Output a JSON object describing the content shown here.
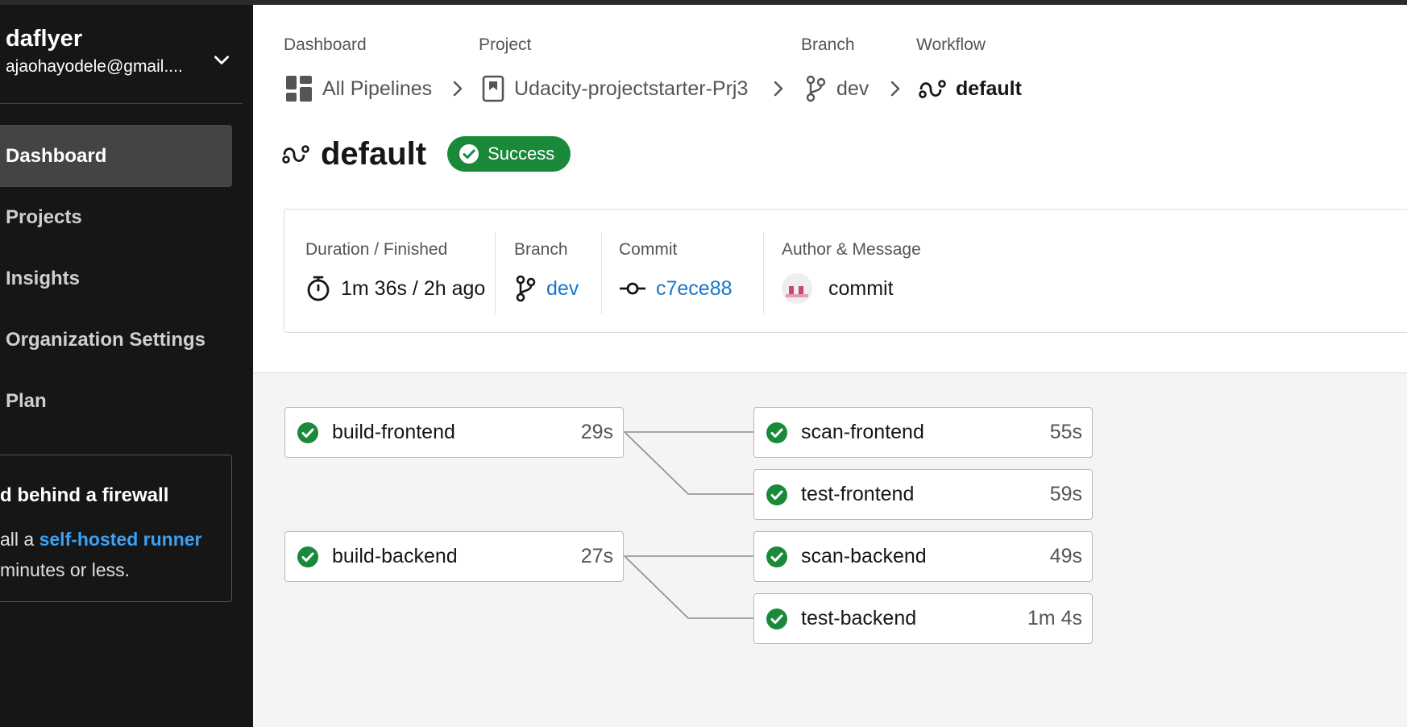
{
  "sidebar": {
    "user": {
      "name": "daflyer",
      "email": "ajaohayodele@gmail...."
    },
    "nav": [
      {
        "label": "Dashboard",
        "active": true
      },
      {
        "label": "Projects"
      },
      {
        "label": "Insights"
      },
      {
        "label": "Organization Settings"
      },
      {
        "label": "Plan"
      }
    ],
    "firewall": {
      "title": "d behind a firewall",
      "text_before": "all a ",
      "link": "self-hosted runner",
      "text_after": "minutes or less."
    }
  },
  "breadcrumb": {
    "dashboard": {
      "label": "Dashboard",
      "value": "All Pipelines"
    },
    "project": {
      "label": "Project",
      "value": "Udacity-projectstarter-Prj3"
    },
    "branch": {
      "label": "Branch",
      "value": "dev"
    },
    "workflow": {
      "label": "Workflow",
      "value": "default"
    }
  },
  "workflow": {
    "title": "default",
    "status": "Success"
  },
  "info": {
    "duration": {
      "label": "Duration / Finished",
      "value": "1m 36s / 2h ago"
    },
    "branch": {
      "label": "Branch",
      "value": "dev"
    },
    "commit": {
      "label": "Commit",
      "value": "c7ece88"
    },
    "author": {
      "label": "Author & Message",
      "value": "commit"
    }
  },
  "jobs": [
    {
      "name": "build-frontend",
      "duration": "29s"
    },
    {
      "name": "scan-frontend",
      "duration": "55s"
    },
    {
      "name": "test-frontend",
      "duration": "59s"
    },
    {
      "name": "build-backend",
      "duration": "27s"
    },
    {
      "name": "scan-backend",
      "duration": "49s"
    },
    {
      "name": "test-backend",
      "duration": "1m 4s"
    }
  ],
  "colors": {
    "success": "#1a8a3a",
    "link": "#1976c9",
    "sidebar_bg": "#161616"
  }
}
